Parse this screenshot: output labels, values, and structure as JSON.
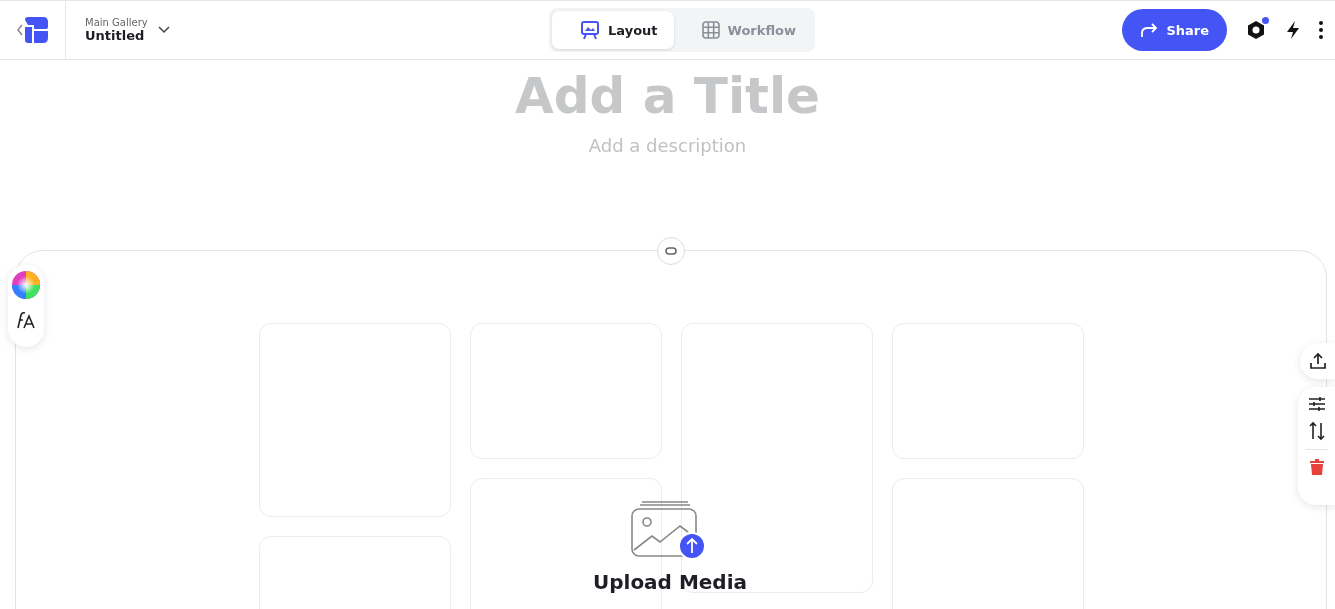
{
  "header": {
    "gallery_label": "Main Gallery",
    "gallery_name": "Untitled"
  },
  "tabs": [
    {
      "kind": "layout",
      "label": "Layout",
      "selected": true
    },
    {
      "kind": "workflow",
      "label": "Workflow",
      "selected": false
    }
  ],
  "share_button": {
    "label": "Share"
  },
  "settings": {
    "notification": true
  },
  "title": {
    "placeholder": "Add a Title"
  },
  "description": {
    "placeholder": "Add a description"
  },
  "upload": {
    "label": "Upload Media"
  }
}
